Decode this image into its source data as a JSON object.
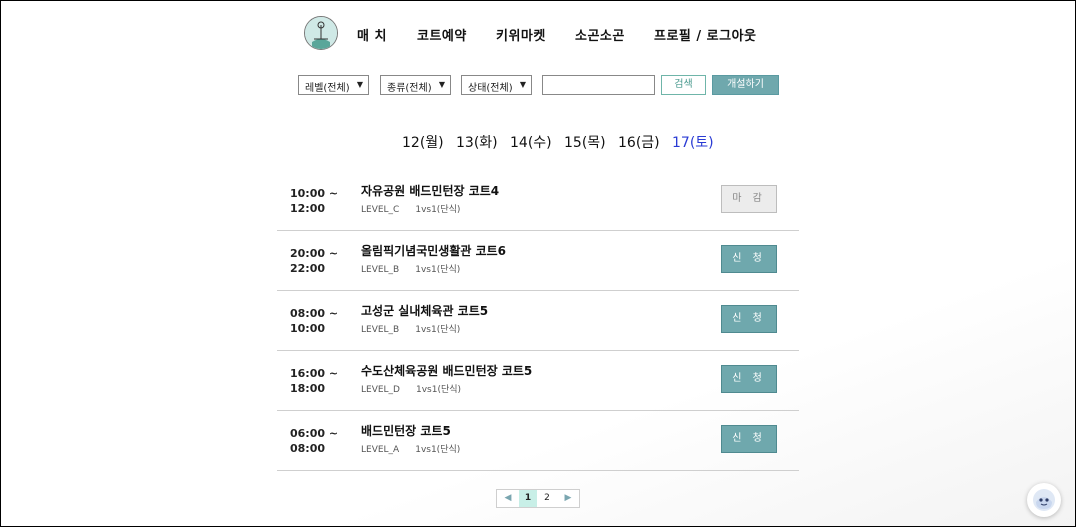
{
  "header": {
    "logo_icon": "badminton-logo-icon",
    "nav": [
      "매 치",
      "코트예약",
      "키위마켓",
      "소곤소곤",
      "프로필 / 로그아웃"
    ]
  },
  "filters": {
    "level": "레벨(전체)",
    "type": "종류(전체)",
    "status": "상태(전체)",
    "search_value": "",
    "search_button": "검색",
    "create_button": "개설하기"
  },
  "dates": {
    "items": [
      "12(월)",
      "13(화)",
      "14(수)",
      "15(목)",
      "16(금)",
      "17(토)"
    ],
    "selected": "17(토)",
    "selected_color": "#2a3bd4"
  },
  "matches": [
    {
      "start": "10:00 ~",
      "end": "12:00",
      "court": "자유공원 배드민턴장 코트4",
      "level": "LEVEL_C",
      "type": "1vs1(단식)",
      "action": "마 감",
      "state": "closed"
    },
    {
      "start": "20:00 ~",
      "end": "22:00",
      "court": "올림픽기념국민생활관 코트6",
      "level": "LEVEL_B",
      "type": "1vs1(단식)",
      "action": "신 청",
      "state": "open"
    },
    {
      "start": "08:00 ~",
      "end": "10:00",
      "court": "고성군 실내체육관 코트5",
      "level": "LEVEL_B",
      "type": "1vs1(단식)",
      "action": "신 청",
      "state": "open"
    },
    {
      "start": "16:00 ~",
      "end": "18:00",
      "court": "수도산체육공원 배드민턴장 코트5",
      "level": "LEVEL_D",
      "type": "1vs1(단식)",
      "action": "신 청",
      "state": "open"
    },
    {
      "start": "06:00 ~",
      "end": "08:00",
      "court": "배드민턴장 코트5",
      "level": "LEVEL_A",
      "type": "1vs1(단식)",
      "action": "신 청",
      "state": "open"
    }
  ],
  "pagination": {
    "prev_icon": "triangle-left-icon",
    "pages": [
      "1",
      "2"
    ],
    "current": "1",
    "next_icon": "triangle-right-icon"
  },
  "colors": {
    "accent": "#6fa8ad",
    "page_highlight": "#c8efe7"
  },
  "chatbot_icon": "chatbot-face-icon"
}
